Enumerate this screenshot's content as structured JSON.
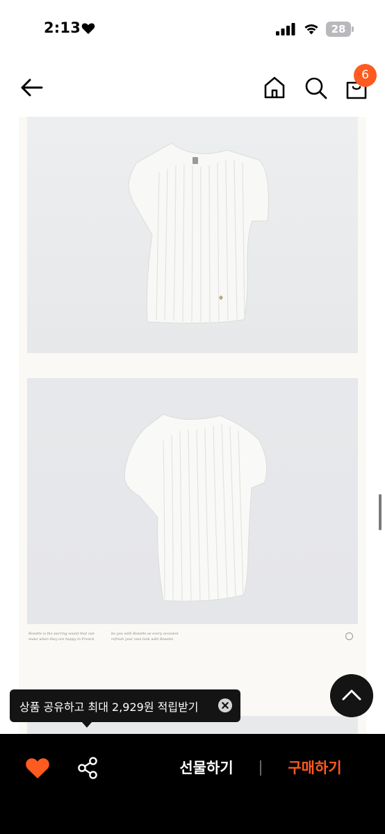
{
  "status_bar": {
    "time": "2:13",
    "battery_level": "28",
    "icons": [
      "heart-icon",
      "cellular-signal-icon",
      "wifi-icon",
      "battery-icon"
    ]
  },
  "header": {
    "icons": [
      "back-arrow-icon",
      "home-icon",
      "search-icon",
      "shopping-bag-icon"
    ],
    "cart_count": "6"
  },
  "product_images": {
    "caption_left": "Rosette is the purring sound that can make when they are happy in French",
    "caption_right": "be you with Rosette as every occasion refresh your own look with Rosette"
  },
  "share_tooltip": {
    "text": "상품 공유하고 최대 2,929원 적립받기"
  },
  "bottom_bar": {
    "gift_label": "선물하기",
    "buy_label": "구매하기",
    "like_active": true
  },
  "colors": {
    "accent": "#ff5a1f",
    "bar": "#000000",
    "photo_bg": "#e9eaec",
    "page_bg": "#fbf9f5"
  }
}
